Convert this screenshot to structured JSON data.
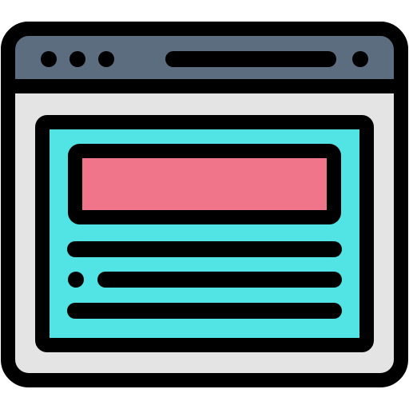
{
  "icon": {
    "name": "browser-window-icon",
    "colors": {
      "outline": "#000000",
      "title_bar": "#5D6D80",
      "window_body": "#E4E4E4",
      "content_panel": "#52E3E4",
      "hero_block": "#F0758A",
      "dots": "#000000"
    }
  }
}
